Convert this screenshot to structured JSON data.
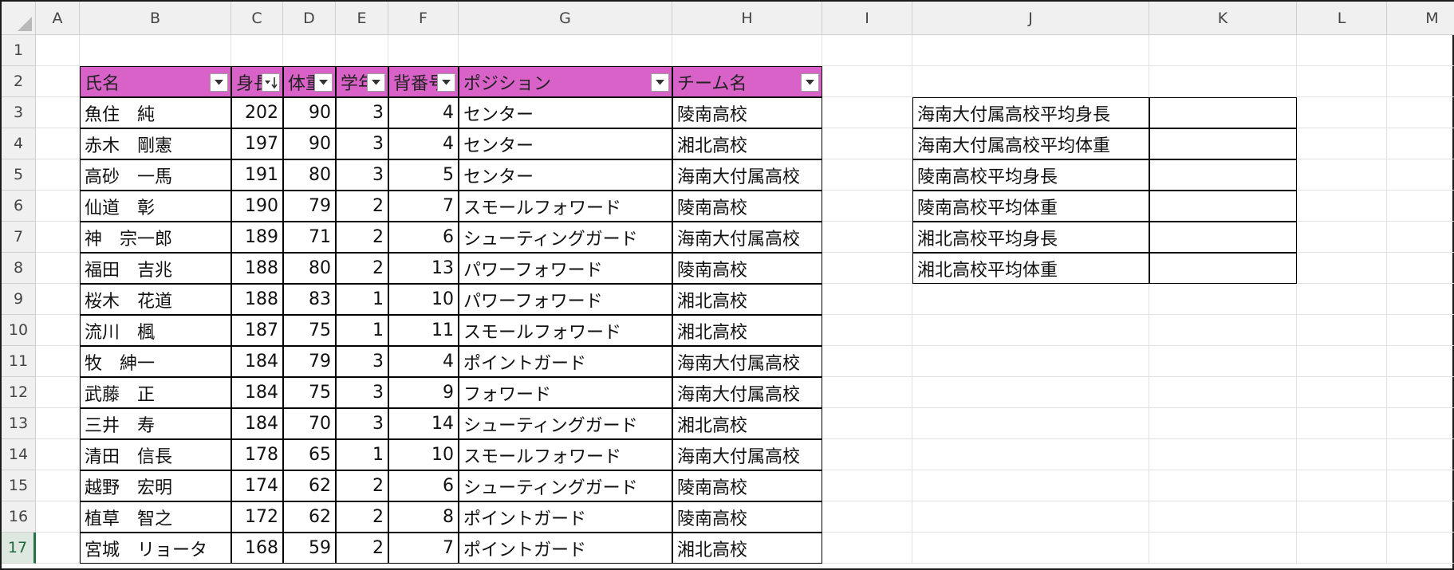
{
  "columns": [
    "A",
    "B",
    "C",
    "D",
    "E",
    "F",
    "G",
    "H",
    "I",
    "J",
    "K",
    "L",
    "M"
  ],
  "rows": [
    "1",
    "2",
    "3",
    "4",
    "5",
    "6",
    "7",
    "8",
    "9",
    "10",
    "11",
    "12",
    "13",
    "14",
    "15",
    "16",
    "17"
  ],
  "active_row": "17",
  "table": {
    "headers": [
      "氏名",
      "身長",
      "体重",
      "学年",
      "背番号",
      "ポジション",
      "チーム名"
    ],
    "sorted_column_index": 1,
    "rows": [
      [
        "魚住　純",
        "202",
        "90",
        "3",
        "4",
        "センター",
        "陵南高校"
      ],
      [
        "赤木　剛憲",
        "197",
        "90",
        "3",
        "4",
        "センター",
        "湘北高校"
      ],
      [
        "高砂　一馬",
        "191",
        "80",
        "3",
        "5",
        "センター",
        "海南大付属高校"
      ],
      [
        "仙道　彰",
        "190",
        "79",
        "2",
        "7",
        "スモールフォワード",
        "陵南高校"
      ],
      [
        "神　宗一郎",
        "189",
        "71",
        "2",
        "6",
        "シューティングガード",
        "海南大付属高校"
      ],
      [
        "福田　吉兆",
        "188",
        "80",
        "2",
        "13",
        "パワーフォワード",
        "陵南高校"
      ],
      [
        "桜木　花道",
        "188",
        "83",
        "1",
        "10",
        "パワーフォワード",
        "湘北高校"
      ],
      [
        "流川　楓",
        "187",
        "75",
        "1",
        "11",
        "スモールフォワード",
        "湘北高校"
      ],
      [
        "牧　紳一",
        "184",
        "79",
        "3",
        "4",
        "ポイントガード",
        "海南大付属高校"
      ],
      [
        "武藤　正",
        "184",
        "75",
        "3",
        "9",
        "フォワード",
        "海南大付属高校"
      ],
      [
        "三井　寿",
        "184",
        "70",
        "3",
        "14",
        "シューティングガード",
        "湘北高校"
      ],
      [
        "清田　信長",
        "178",
        "65",
        "1",
        "10",
        "スモールフォワード",
        "海南大付属高校"
      ],
      [
        "越野　宏明",
        "174",
        "62",
        "2",
        "6",
        "シューティングガード",
        "陵南高校"
      ],
      [
        "植草　智之",
        "172",
        "62",
        "2",
        "8",
        "ポイントガード",
        "陵南高校"
      ],
      [
        "宮城　リョータ",
        "168",
        "59",
        "2",
        "7",
        "ポイントガード",
        "湘北高校"
      ]
    ]
  },
  "summary": {
    "labels": [
      "海南大付属高校平均身長",
      "海南大付属高校平均体重",
      "陵南高校平均身長",
      "陵南高校平均体重",
      "湘北高校平均身長",
      "湘北高校平均体重"
    ],
    "values": [
      "",
      "",
      "",
      "",
      "",
      ""
    ]
  },
  "colors": {
    "header_fill": "#d962c8",
    "active_row_header": "#217346"
  },
  "icons": {
    "filter": "filter-dropdown-icon",
    "sort": "sort-descending-icon"
  }
}
